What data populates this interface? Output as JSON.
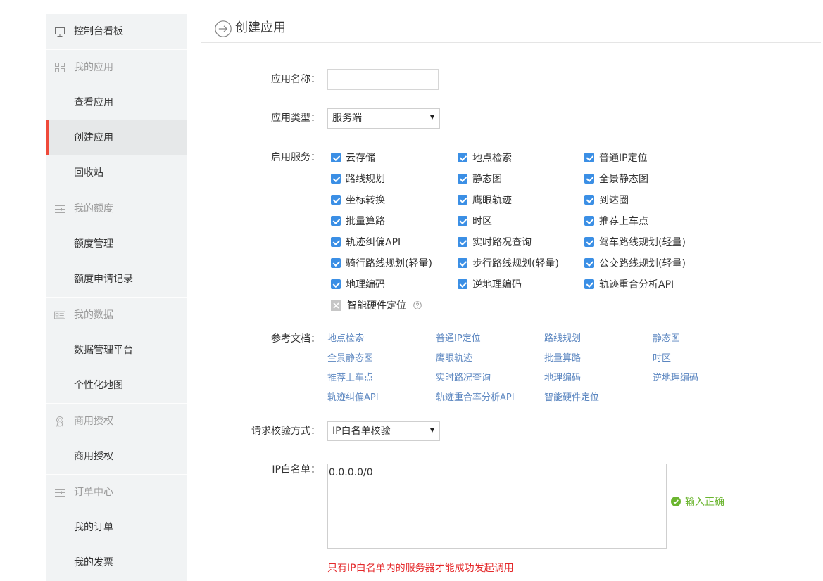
{
  "sidebar": {
    "dashboard": {
      "label": "控制台看板",
      "icon": "monitor-icon"
    },
    "groups": [
      {
        "header": "我的应用",
        "icon": "grid-icon",
        "items": [
          {
            "label": "查看应用",
            "active": false
          },
          {
            "label": "创建应用",
            "active": true
          },
          {
            "label": "回收站",
            "active": false
          }
        ]
      },
      {
        "header": "我的额度",
        "icon": "sliders-icon",
        "items": [
          {
            "label": "额度管理",
            "active": false
          },
          {
            "label": "额度申请记录",
            "active": false
          }
        ]
      },
      {
        "header": "我的数据",
        "icon": "id-card-icon",
        "items": [
          {
            "label": "数据管理平台",
            "active": false
          },
          {
            "label": "个性化地图",
            "active": false
          }
        ]
      },
      {
        "header": "商用授权",
        "icon": "award-icon",
        "items": [
          {
            "label": "商用授权",
            "active": false
          }
        ]
      },
      {
        "header": "订单中心",
        "icon": "list-icon",
        "items": [
          {
            "label": "我的订单",
            "active": false
          },
          {
            "label": "我的发票",
            "active": false
          }
        ]
      }
    ]
  },
  "page": {
    "title": "创建应用",
    "title_icon": "arrow-circle-right-icon"
  },
  "form": {
    "app_name": {
      "label": "应用名称：",
      "value": ""
    },
    "app_type": {
      "label": "应用类型：",
      "value": "服务端"
    },
    "services": {
      "label": "启用服务：",
      "items": [
        {
          "name": "云存储",
          "checked": true
        },
        {
          "name": "地点检索",
          "checked": true
        },
        {
          "name": "普通IP定位",
          "checked": true
        },
        {
          "name": "路线规划",
          "checked": true
        },
        {
          "name": "静态图",
          "checked": true
        },
        {
          "name": "全景静态图",
          "checked": true
        },
        {
          "name": "坐标转换",
          "checked": true
        },
        {
          "name": "鹰眼轨迹",
          "checked": true
        },
        {
          "name": "到达圈",
          "checked": true
        },
        {
          "name": "批量算路",
          "checked": true
        },
        {
          "name": "时区",
          "checked": true
        },
        {
          "name": "推荐上车点",
          "checked": true
        },
        {
          "name": "轨迹纠偏API",
          "checked": true
        },
        {
          "name": "实时路况查询",
          "checked": true
        },
        {
          "name": "驾车路线规划(轻量)",
          "checked": true
        },
        {
          "name": "骑行路线规划(轻量)",
          "checked": true
        },
        {
          "name": "步行路线规划(轻量)",
          "checked": true
        },
        {
          "name": "公交路线规划(轻量)",
          "checked": true
        },
        {
          "name": "地理编码",
          "checked": true
        },
        {
          "name": "逆地理编码",
          "checked": true
        },
        {
          "name": "轨迹重合分析API",
          "checked": true
        }
      ],
      "disabled_item": {
        "name": "智能硬件定位",
        "checked": false,
        "disabled": true,
        "help_icon": "question-circle-icon"
      }
    },
    "docs": {
      "label": "参考文档：",
      "links": [
        "地点检索",
        "普通IP定位",
        "路线规划",
        "静态图",
        "全景静态图",
        "鹰眼轨迹",
        "批量算路",
        "时区",
        "推荐上车点",
        "实时路况查询",
        "地理编码",
        "逆地理编码",
        "轨迹纠偏API",
        "轨迹重合率分析API",
        "智能硬件定位"
      ]
    },
    "auth_method": {
      "label": "请求校验方式：",
      "value": "IP白名单校验"
    },
    "ip_whitelist": {
      "label": "IP白名单：",
      "value": "0.0.0.0/0",
      "status": "输入正确",
      "status_icon": "check-circle-icon",
      "note": "只有IP白名单内的服务器才能成功发起调用"
    }
  },
  "colors": {
    "accent": "#3b8fe5",
    "active_indicator": "#ef4a3a",
    "link": "#5b86c0",
    "success": "#6bb52f",
    "error": "#e4292b",
    "sidebar_bg": "#f1f3f4"
  }
}
